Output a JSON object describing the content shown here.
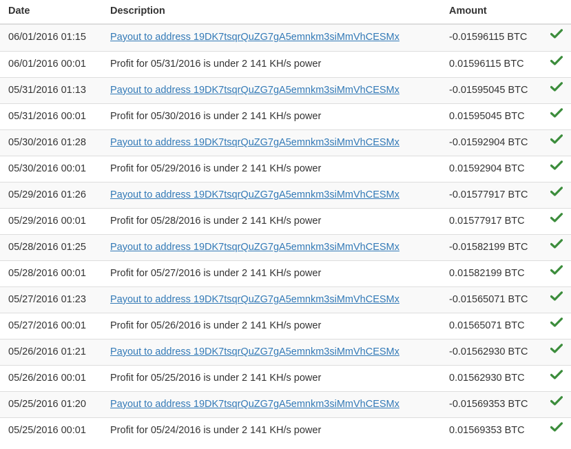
{
  "table": {
    "headers": {
      "date": "Date",
      "description": "Description",
      "amount": "Amount"
    },
    "rows": [
      {
        "date": "06/01/2016 01:15",
        "description": "Payout to address 19DK7tsqrQuZG7gA5emnkm3siMmVhCESMx",
        "amount": "-0.01596115 BTC",
        "is_link": true,
        "status_icon": "check-icon"
      },
      {
        "date": "06/01/2016 00:01",
        "description": "Profit for 05/31/2016 is under 2 141 KH/s power",
        "amount": "0.01596115 BTC",
        "is_link": false,
        "status_icon": "check-icon"
      },
      {
        "date": "05/31/2016 01:13",
        "description": "Payout to address 19DK7tsqrQuZG7gA5emnkm3siMmVhCESMx",
        "amount": "-0.01595045 BTC",
        "is_link": true,
        "status_icon": "check-icon"
      },
      {
        "date": "05/31/2016 00:01",
        "description": "Profit for 05/30/2016 is under 2 141 KH/s power",
        "amount": "0.01595045 BTC",
        "is_link": false,
        "status_icon": "check-icon"
      },
      {
        "date": "05/30/2016 01:28",
        "description": "Payout to address 19DK7tsqrQuZG7gA5emnkm3siMmVhCESMx",
        "amount": "-0.01592904 BTC",
        "is_link": true,
        "status_icon": "check-icon"
      },
      {
        "date": "05/30/2016 00:01",
        "description": "Profit for 05/29/2016 is under 2 141 KH/s power",
        "amount": "0.01592904 BTC",
        "is_link": false,
        "status_icon": "check-icon"
      },
      {
        "date": "05/29/2016 01:26",
        "description": "Payout to address 19DK7tsqrQuZG7gA5emnkm3siMmVhCESMx",
        "amount": "-0.01577917 BTC",
        "is_link": true,
        "status_icon": "check-icon"
      },
      {
        "date": "05/29/2016 00:01",
        "description": "Profit for 05/28/2016 is under 2 141 KH/s power",
        "amount": "0.01577917 BTC",
        "is_link": false,
        "status_icon": "check-icon"
      },
      {
        "date": "05/28/2016 01:25",
        "description": "Payout to address 19DK7tsqrQuZG7gA5emnkm3siMmVhCESMx",
        "amount": "-0.01582199 BTC",
        "is_link": true,
        "status_icon": "check-icon"
      },
      {
        "date": "05/28/2016 00:01",
        "description": "Profit for 05/27/2016 is under 2 141 KH/s power",
        "amount": "0.01582199 BTC",
        "is_link": false,
        "status_icon": "check-icon"
      },
      {
        "date": "05/27/2016 01:23",
        "description": "Payout to address 19DK7tsqrQuZG7gA5emnkm3siMmVhCESMx",
        "amount": "-0.01565071 BTC",
        "is_link": true,
        "status_icon": "check-icon"
      },
      {
        "date": "05/27/2016 00:01",
        "description": "Profit for 05/26/2016 is under 2 141 KH/s power",
        "amount": "0.01565071 BTC",
        "is_link": false,
        "status_icon": "check-icon"
      },
      {
        "date": "05/26/2016 01:21",
        "description": "Payout to address 19DK7tsqrQuZG7gA5emnkm3siMmVhCESMx",
        "amount": "-0.01562930 BTC",
        "is_link": true,
        "status_icon": "check-icon"
      },
      {
        "date": "05/26/2016 00:01",
        "description": "Profit for 05/25/2016 is under 2 141 KH/s power",
        "amount": "0.01562930 BTC",
        "is_link": false,
        "status_icon": "check-icon"
      },
      {
        "date": "05/25/2016 01:20",
        "description": "Payout to address 19DK7tsqrQuZG7gA5emnkm3siMmVhCESMx",
        "amount": "-0.01569353 BTC",
        "is_link": true,
        "status_icon": "check-icon"
      },
      {
        "date": "05/25/2016 00:01",
        "description": "Profit for 05/24/2016 is under 2 141 KH/s power",
        "amount": "0.01569353 BTC",
        "is_link": false,
        "status_icon": "check-icon"
      }
    ]
  },
  "colors": {
    "link": "#337ab7",
    "check": "#3c8d3c",
    "row_stripe": "#f9f9f9",
    "border": "#dddddd",
    "text": "#333333"
  }
}
